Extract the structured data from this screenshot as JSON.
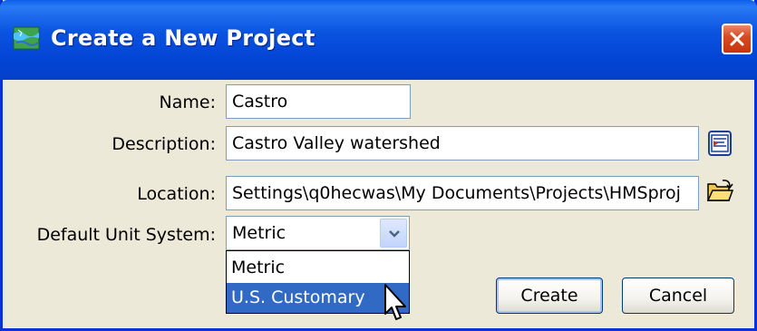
{
  "window": {
    "title": "Create a New Project",
    "title_icon": "project-map-icon",
    "close_icon": "close-icon"
  },
  "form": {
    "name_label": "Name:",
    "name_value": "Castro",
    "description_label": "Description:",
    "description_value": "Castro Valley watershed",
    "description_button_icon": "text-editor-icon",
    "location_label": "Location:",
    "location_value": "Settings\\q0hecwas\\My Documents\\Projects\\HMSproj",
    "location_button_icon": "folder-open-icon",
    "unit_label": "Default Unit System:",
    "unit_selected": "Metric",
    "unit_options": [
      "Metric",
      "U.S. Customary"
    ],
    "unit_highlighted": "U.S. Customary"
  },
  "buttons": {
    "create_label": "Create",
    "cancel_label": "Cancel"
  },
  "colors": {
    "titlebar": "#0a54e0",
    "dialog_bg": "#ece9d8",
    "selection": "#316ac5",
    "close": "#d84b22"
  }
}
